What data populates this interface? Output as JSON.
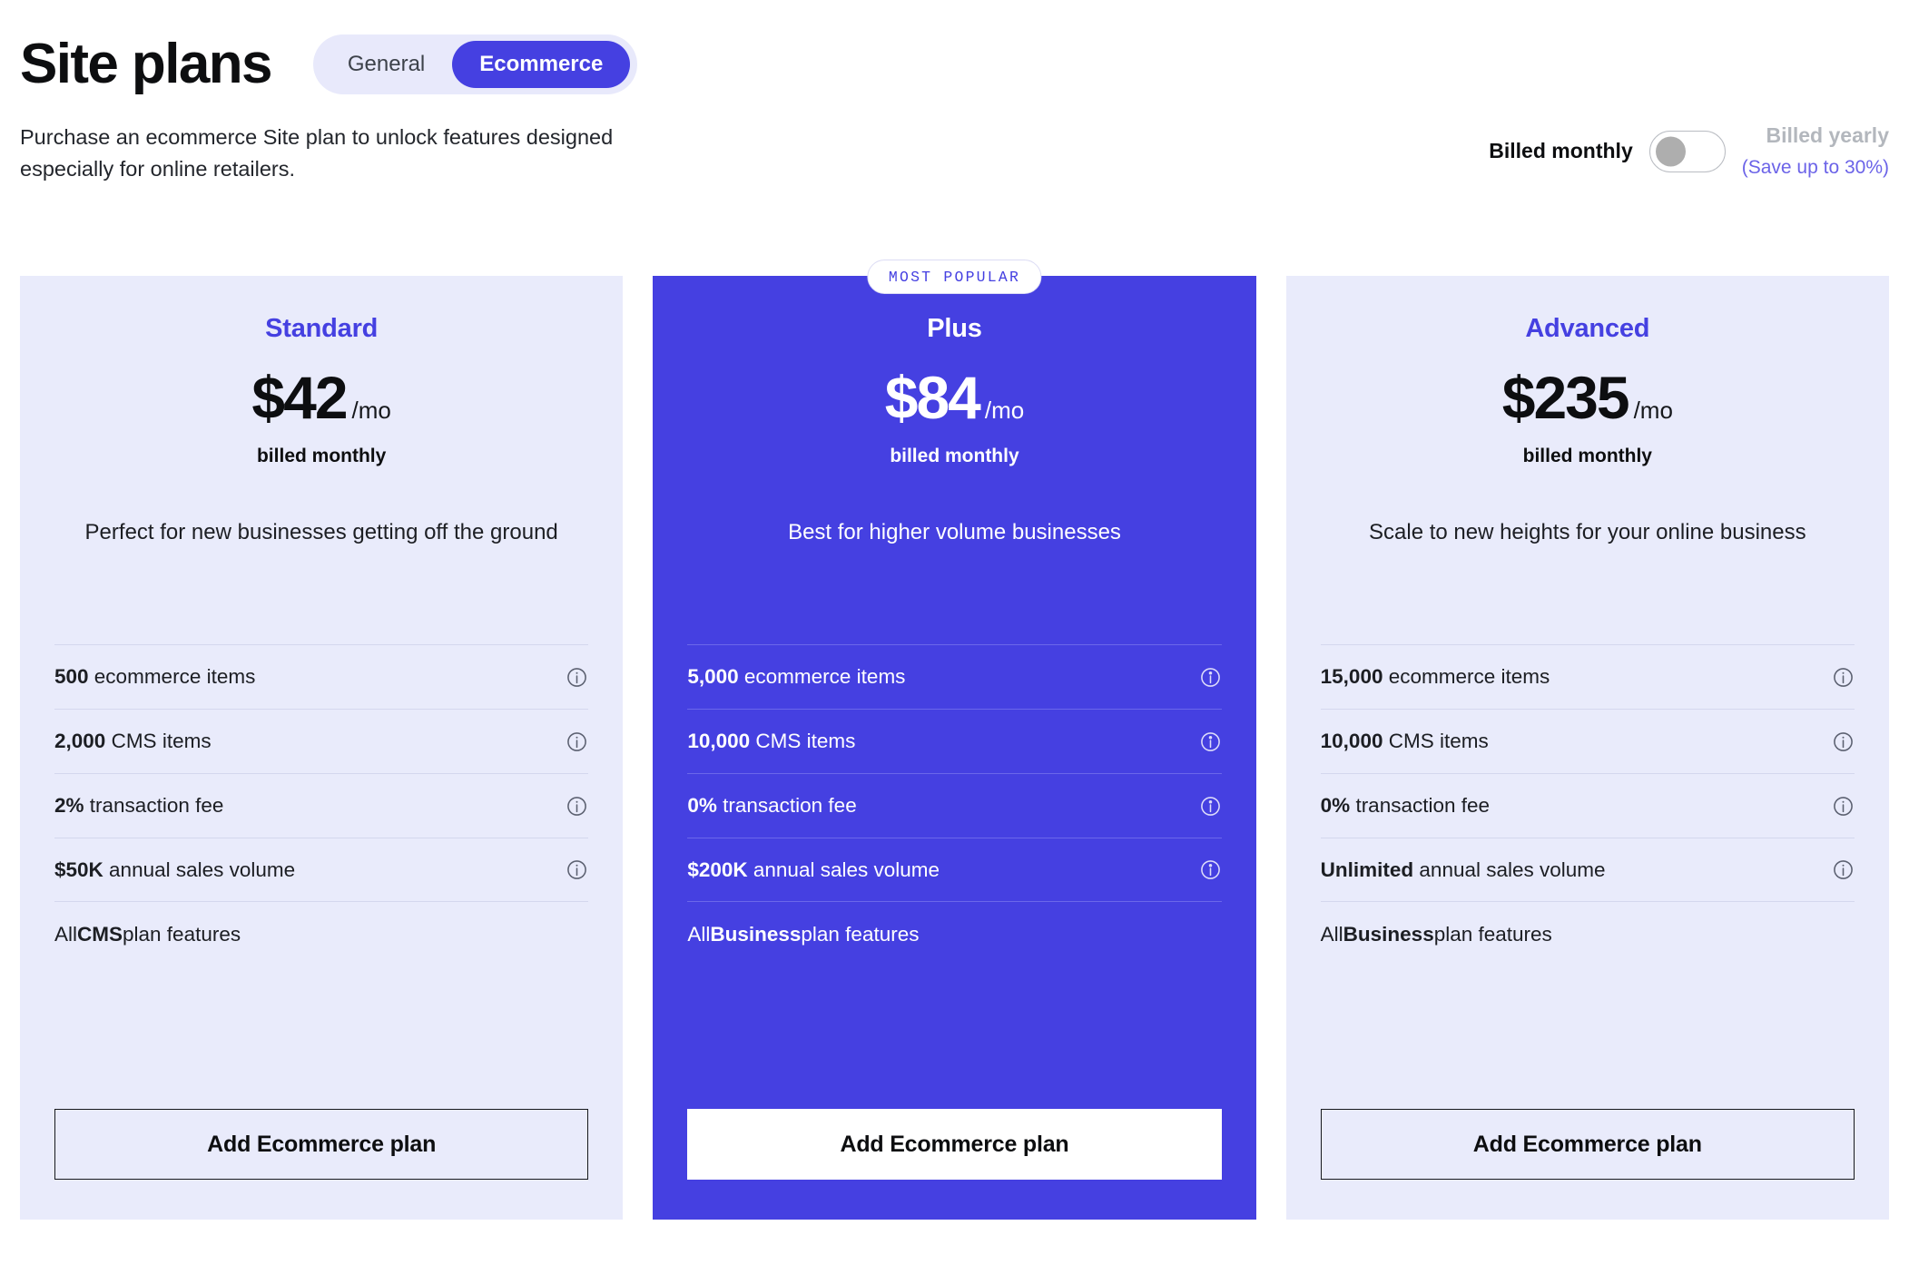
{
  "header": {
    "title": "Site plans",
    "tabs": [
      {
        "label": "General",
        "active": false
      },
      {
        "label": "Ecommerce",
        "active": true
      }
    ]
  },
  "intro": "Purchase an ecommerce Site plan to unlock features designed especially for online retailers.",
  "billing": {
    "monthly_label": "Billed monthly",
    "yearly_label": "Billed yearly",
    "save_note": "(Save up to 30%)",
    "selected": "monthly"
  },
  "colors": {
    "accent": "#4540e1",
    "card_light_bg": "#e9ebfb",
    "featured_bg": "#4540e1",
    "muted_text": "#b3b7bd",
    "save_note": "#6b63e8"
  },
  "plans": [
    {
      "badge": "",
      "name": "Standard",
      "price": "$42",
      "period": "/mo",
      "billed": "billed monthly",
      "tagline": "Perfect for new businesses getting off the ground",
      "features": [
        {
          "value": "500",
          "label": " ecommerce items",
          "info": "info-icon"
        },
        {
          "value": "2,000",
          "label": " CMS items",
          "info": "info-icon"
        },
        {
          "value": "2%",
          "label": " transaction fee",
          "info": "info-icon"
        },
        {
          "value": "$50K",
          "label": " annual sales volume",
          "info": "info-icon"
        }
      ],
      "includes_prefix": "All ",
      "includes_bold": "CMS",
      "includes_suffix": " plan features",
      "cta": "Add Ecommerce plan"
    },
    {
      "badge": "MOST POPULAR",
      "name": "Plus",
      "price": "$84",
      "period": "/mo",
      "billed": "billed monthly",
      "tagline": "Best for higher volume businesses",
      "features": [
        {
          "value": "5,000",
          "label": " ecommerce items",
          "info": "info-icon"
        },
        {
          "value": "10,000",
          "label": " CMS items",
          "info": "info-icon"
        },
        {
          "value": "0%",
          "label": " transaction fee",
          "info": "info-icon"
        },
        {
          "value": "$200K",
          "label": " annual sales volume",
          "info": "info-icon"
        }
      ],
      "includes_prefix": "All ",
      "includes_bold": "Business",
      "includes_suffix": " plan features",
      "cta": "Add Ecommerce plan"
    },
    {
      "badge": "",
      "name": "Advanced",
      "price": "$235",
      "period": "/mo",
      "billed": "billed monthly",
      "tagline": "Scale to new heights for your online business",
      "features": [
        {
          "value": "15,000",
          "label": " ecommerce items",
          "info": "info-icon"
        },
        {
          "value": "10,000",
          "label": " CMS items",
          "info": "info-icon"
        },
        {
          "value": "0%",
          "label": " transaction fee",
          "info": "info-icon"
        },
        {
          "value": "Unlimited",
          "label": " annual sales volume",
          "info": "info-icon"
        }
      ],
      "includes_prefix": "All ",
      "includes_bold": "Business",
      "includes_suffix": " plan features",
      "cta": "Add Ecommerce plan"
    }
  ]
}
